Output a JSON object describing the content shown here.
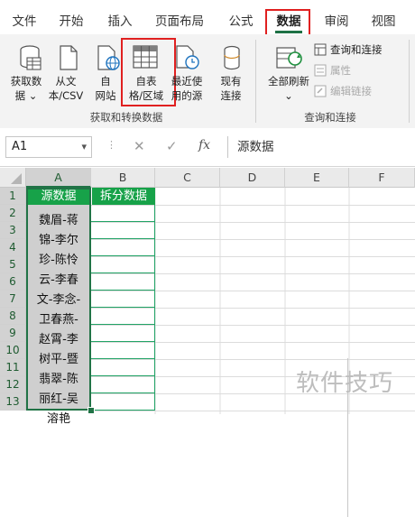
{
  "tabs": [
    {
      "label": "文件"
    },
    {
      "label": "开始"
    },
    {
      "label": "插入"
    },
    {
      "label": "页面布局"
    },
    {
      "label": "公式"
    },
    {
      "label": "数据"
    },
    {
      "label": "审阅"
    },
    {
      "label": "视图"
    }
  ],
  "ribbon": {
    "get_data": {
      "line1": "获取数",
      "line2": "据 ⌄"
    },
    "from_text": {
      "line1": "从文",
      "line2": "本/CSV"
    },
    "from_web": {
      "line1": "自",
      "line2": "网站"
    },
    "from_table": {
      "line1": "自表",
      "line2": "格/区域"
    },
    "recent_sources": {
      "line1": "最近使",
      "line2": "用的源"
    },
    "existing_conn": {
      "line1": "现有",
      "line2": "连接"
    },
    "refresh_all": {
      "line1": "全部刷新",
      "line2": "⌄"
    },
    "queries_connections": "查询和连接",
    "properties": "属性",
    "edit_links": "编辑链接",
    "group_get_transform": "获取和转换数据",
    "group_queries": "查询和连接"
  },
  "formula_bar": {
    "name_box": "A1",
    "name_dropdown": "▾",
    "cancel_glyph": "✕",
    "enter_glyph": "✓",
    "fx_glyph": "fx",
    "formula": "源数据"
  },
  "columns": [
    "A",
    "B",
    "C",
    "D",
    "E",
    "F"
  ],
  "rows": [
    "1",
    "2",
    "3",
    "4",
    "5",
    "6",
    "7",
    "8",
    "9",
    "10",
    "11",
    "12",
    "13"
  ],
  "cells": {
    "A1": "源数据",
    "B1": "拆分数据",
    "A2_wrapped_lines": [
      "魏眉-蒋",
      "锦-李尔",
      "珍-陈怜",
      "云-李春",
      "文-李念-",
      "卫春燕-",
      "赵霄-李",
      "树平-暨",
      "翡翠-陈",
      "丽红-吴",
      "溶艳"
    ]
  },
  "watermark": "软件技巧",
  "colors": {
    "accent_green": "#217346",
    "header_fill": "#17a249",
    "highlight_red": "#e02020"
  }
}
